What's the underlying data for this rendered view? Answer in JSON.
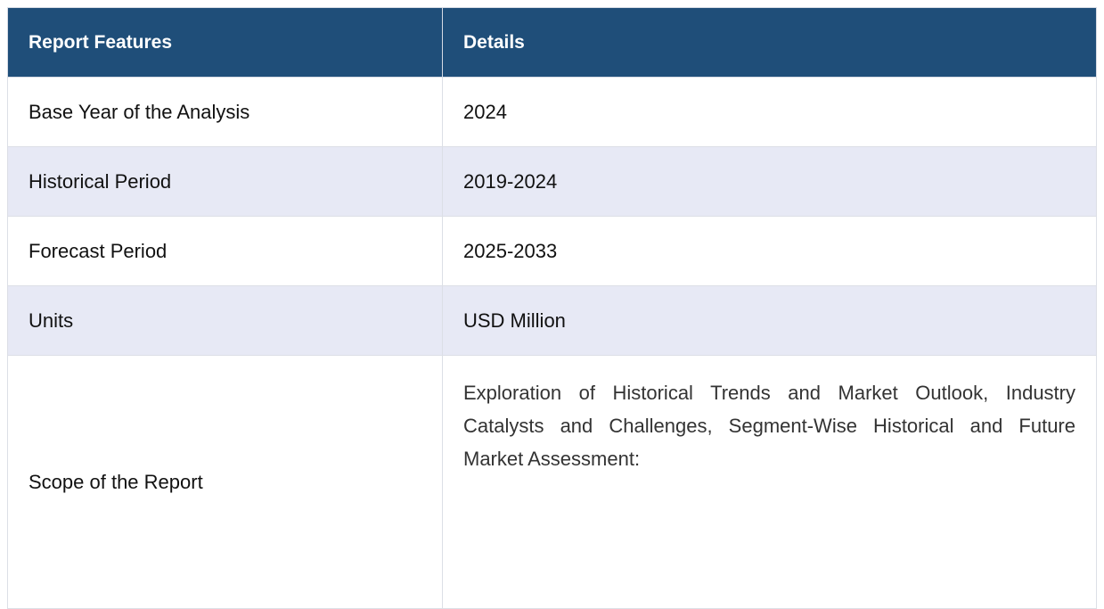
{
  "table": {
    "headers": [
      "Report Features",
      "Details"
    ],
    "rows": [
      {
        "feature": "Base Year of the Analysis",
        "details": "2024"
      },
      {
        "feature": "Historical Period",
        "details": "2019-2024"
      },
      {
        "feature": "Forecast Period",
        "details": "2025-2033"
      },
      {
        "feature": "Units",
        "details": "USD Million"
      },
      {
        "feature": "Scope of the Report",
        "details": "Exploration of Historical Trends and Market Outlook, Industry Catalysts and Challenges, Segment-Wise Historical and Future Market Assessment:"
      }
    ]
  },
  "colors": {
    "header_bg": "#1f4e79",
    "alt_row_bg": "#e7e9f5",
    "border": "#dcdfe6"
  }
}
